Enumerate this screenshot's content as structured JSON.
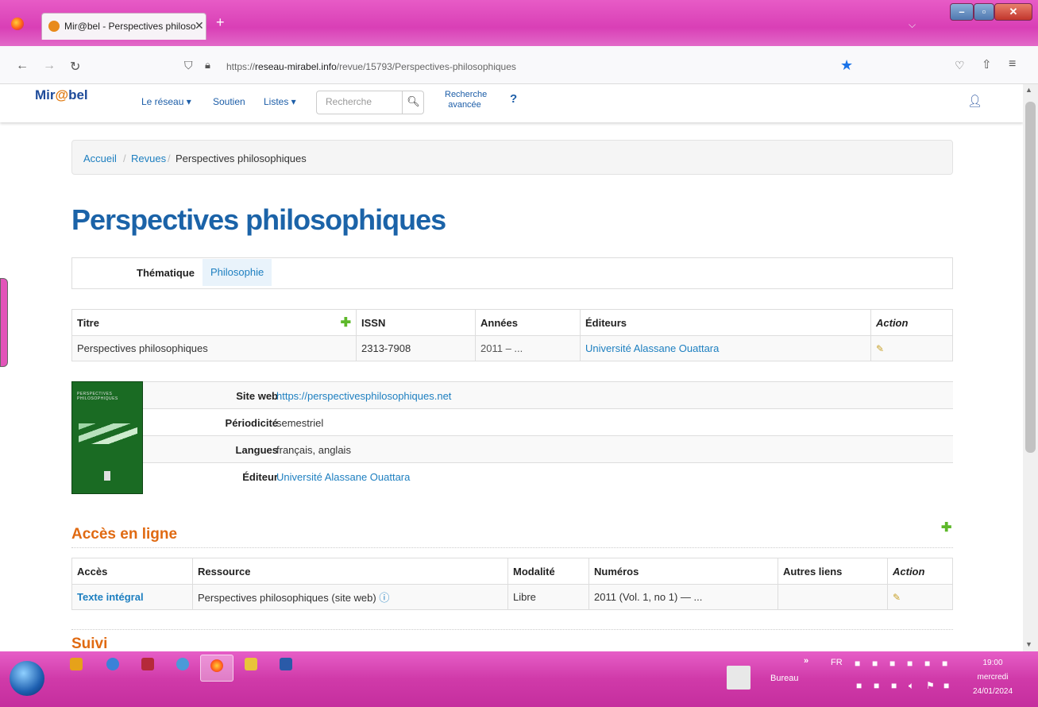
{
  "browser": {
    "tab_title": "Mir@bel - Perspectives philoso",
    "url_host": "reseau-mirabel.info",
    "url_prefix": "https://",
    "url_path": "/revue/15793/Perspectives-philosophiques"
  },
  "site": {
    "logo_text": "Mir",
    "logo_at": "@",
    "logo_end": "bel",
    "nav": {
      "reseau": "Le réseau ▾",
      "soutien": "Soutien",
      "listes": "Listes ▾",
      "search_placeholder": "Recherche",
      "advanced_1": "Recherche",
      "advanced_2": "avancée",
      "help": "?"
    }
  },
  "breadcrumb": [
    "Accueil",
    "Revues",
    "Perspectives philosophiques"
  ],
  "page_title": "Perspectives philosophiques",
  "thematique": {
    "label": "Thématique",
    "value": "Philosophie"
  },
  "titles_table": {
    "headers": [
      "Titre",
      "ISSN",
      "Années",
      "Éditeurs",
      "Action"
    ],
    "row": [
      "Perspectives philosophiques",
      "2313-7908",
      "2011 – ...",
      "Université Alassane Ouattara"
    ]
  },
  "cover": {
    "title": "PERSPECTIVES PHILOSOPHIQUES"
  },
  "details": [
    {
      "label": "Site web",
      "value": "https://perspectivesphilosophiques.net"
    },
    {
      "label": "Périodicité",
      "value": "semestriel"
    },
    {
      "label": "Langues",
      "value": "français, anglais"
    },
    {
      "label": "Éditeur",
      "value": "Université Alassane Ouattara"
    }
  ],
  "acces": {
    "heading": "Accès en ligne",
    "headers": [
      "Accès",
      "Ressource",
      "Modalité",
      "Numéros",
      "Autres liens",
      "Action"
    ],
    "row": [
      "Texte intégral",
      "Perspectives philosophiques (site web)",
      "Libre",
      "2011 (Vol. 1, no 1) — ..."
    ]
  },
  "suivi_heading": "Suivi",
  "taskbar": {
    "bureau": "Bureau",
    "lang": "FR",
    "time": "19:00",
    "day": "mercredi",
    "date": "24/01/2024"
  },
  "colors": {
    "accent_blue": "#1b63a8",
    "link": "#1d7fc0",
    "orange": "#e06a12",
    "taskbar": "#d93fb6"
  }
}
